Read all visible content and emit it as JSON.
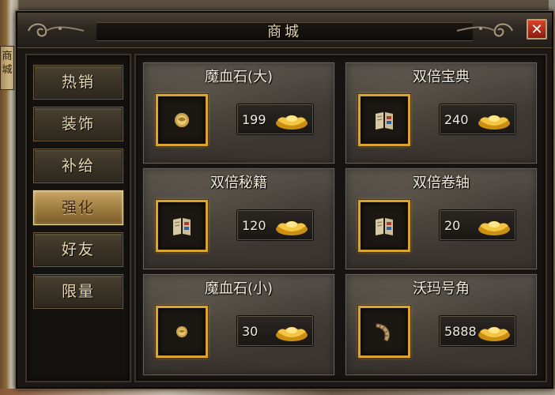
{
  "window": {
    "title": "商城",
    "close_label": "✕"
  },
  "background": {
    "left_tab_text": "商城"
  },
  "sidebar": {
    "items": [
      {
        "label": "热销",
        "active": false
      },
      {
        "label": "装饰",
        "active": false
      },
      {
        "label": "补给",
        "active": false
      },
      {
        "label": "强化",
        "active": true
      },
      {
        "label": "好友",
        "active": false
      },
      {
        "label": "限量",
        "active": false
      }
    ]
  },
  "products": [
    {
      "name": "魔血石(大)",
      "price": "199",
      "icon": "blood-stone-icon"
    },
    {
      "name": "双倍宝典",
      "price": "240",
      "icon": "book-icon"
    },
    {
      "name": "双倍秘籍",
      "price": "120",
      "icon": "book-icon"
    },
    {
      "name": "双倍卷轴",
      "price": "20",
      "icon": "book-icon"
    },
    {
      "name": "魔血石(小)",
      "price": "30",
      "icon": "blood-stone-icon"
    },
    {
      "name": "沃玛号角",
      "price": "5888",
      "icon": "horn-icon"
    }
  ],
  "colors": {
    "gold_border": "#d9a52e",
    "active_tab": "#c7a566",
    "text": "#f3ecdc"
  }
}
